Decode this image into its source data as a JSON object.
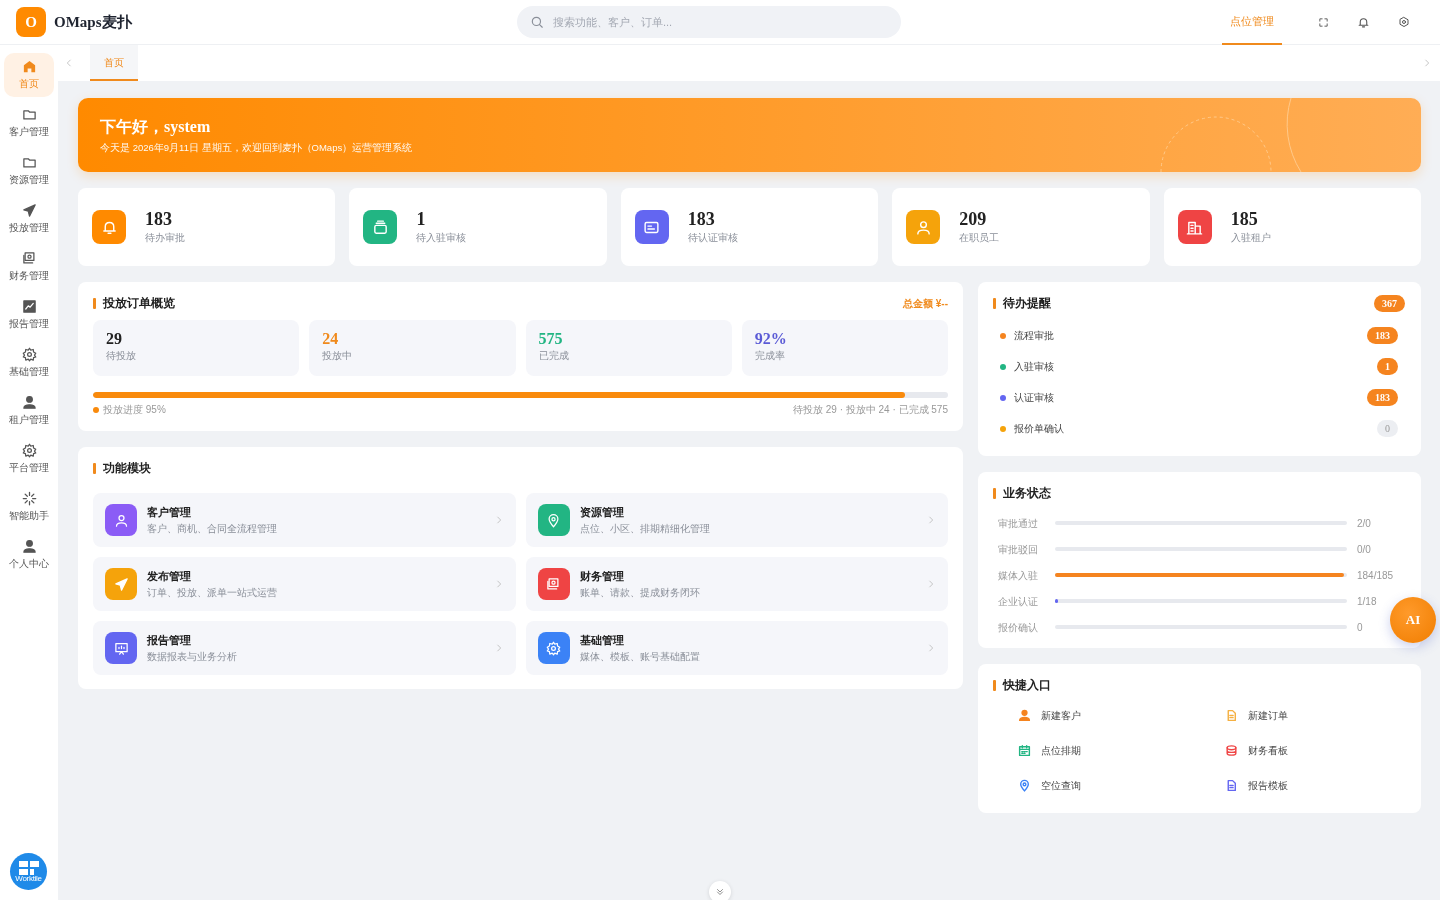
{
  "header": {
    "logo_letter": "O",
    "brand": "OMaps麦扑",
    "search": {
      "placeholder": "搜索功能、客户、订单..."
    },
    "nav": [
      {
        "label": "点位管理",
        "selected": true
      }
    ]
  },
  "sidebar": {
    "items": [
      {
        "label": "首页",
        "selected": true
      },
      {
        "label": "客户管理",
        "selected": false
      },
      {
        "label": "资源管理",
        "selected": false
      },
      {
        "label": "投放管理",
        "selected": false
      },
      {
        "label": "财务管理",
        "selected": false
      },
      {
        "label": "报告管理",
        "selected": false
      },
      {
        "label": "基础管理",
        "selected": false
      },
      {
        "label": "租户管理",
        "selected": false
      },
      {
        "label": "平台管理",
        "selected": false
      },
      {
        "label": "智能助手",
        "selected": false
      },
      {
        "label": "个人中心",
        "selected": false
      }
    ],
    "app_badge": "Worktile"
  },
  "tabs": [
    {
      "label": "首页",
      "selected": true
    }
  ],
  "banner": {
    "greeting": "下午好，system",
    "subtitle": "今天是 2026年9月11日 星期五，欢迎回到麦扑（OMaps）运营管理系统"
  },
  "stats": [
    {
      "value": "183",
      "label": "待办审批",
      "color": "#ff8a00"
    },
    {
      "value": "1",
      "label": "待入驻审核",
      "color": "#22b583"
    },
    {
      "value": "183",
      "label": "待认证审核",
      "color": "#6366f1"
    },
    {
      "value": "209",
      "label": "在职员工",
      "color": "#f5a30b"
    },
    {
      "value": "185",
      "label": "入驻租户",
      "color": "#ef4444"
    }
  ],
  "orders": {
    "title": "投放订单概览",
    "total": "总金额 ¥--",
    "metrics": [
      {
        "value": "29",
        "label": "待投放",
        "color": "#222222"
      },
      {
        "value": "24",
        "label": "投放中",
        "color": "#f08a1c"
      },
      {
        "value": "575",
        "label": "已完成",
        "color": "#22b583"
      },
      {
        "value": "92%",
        "label": "完成率",
        "color": "#5b5bd6"
      }
    ],
    "progress": {
      "level": 0.95,
      "label": "投放进度 95%",
      "summary": "待投放 29 · 投放中 24 · 已完成 575"
    }
  },
  "modules": {
    "title": "功能模块",
    "items": [
      {
        "title": "客户管理",
        "desc": "客户、商机、合同全流程管理",
        "color": "#8b5cf6"
      },
      {
        "title": "资源管理",
        "desc": "点位、小区、排期精细化管理",
        "color": "#22b583"
      },
      {
        "title": "发布管理",
        "desc": "订单、投放、派单一站式运营",
        "color": "#f5a30b"
      },
      {
        "title": "财务管理",
        "desc": "账单、请款、提成财务闭环",
        "color": "#ef4444"
      },
      {
        "title": "报告管理",
        "desc": "数据报表与业务分析",
        "color": "#6366f1"
      },
      {
        "title": "基础管理",
        "desc": "媒体、模板、账号基础配置",
        "color": "#3b82f6"
      }
    ]
  },
  "todo": {
    "title": "待办提醒",
    "total": "367",
    "items": [
      {
        "label": "流程审批",
        "count": "183",
        "color": "#f5841f",
        "muted": false
      },
      {
        "label": "入驻审核",
        "count": "1",
        "color": "#22b583",
        "muted": false
      },
      {
        "label": "认证审核",
        "count": "183",
        "color": "#6366f1",
        "muted": false
      },
      {
        "label": "报价单确认",
        "count": "0",
        "color": "#f5a30b",
        "muted": true
      }
    ]
  },
  "business": {
    "title": "业务状态",
    "rows": [
      {
        "label": "审批通过",
        "reading": "2/0"
      },
      {
        "label": "审批驳回",
        "reading": "0/0"
      },
      {
        "label": "媒体入驻",
        "level": 0.99,
        "reading": "184/185",
        "color": "#f5841f"
      },
      {
        "label": "企业认证",
        "level": 0.01,
        "reading": "1/18",
        "color": "#6366f1"
      },
      {
        "label": "报价确认",
        "reading": "0"
      }
    ]
  },
  "quick": {
    "title": "快捷入口",
    "items": [
      {
        "label": "新建客户",
        "color": "#f5841f"
      },
      {
        "label": "新建订单",
        "color": "#f5b041"
      },
      {
        "label": "点位排期",
        "color": "#22b583"
      },
      {
        "label": "财务看板",
        "color": "#ef4444"
      },
      {
        "label": "空位查询",
        "color": "#3b82f6"
      },
      {
        "label": "报告模板",
        "color": "#6366f1"
      }
    ]
  },
  "ai_button": "AI"
}
